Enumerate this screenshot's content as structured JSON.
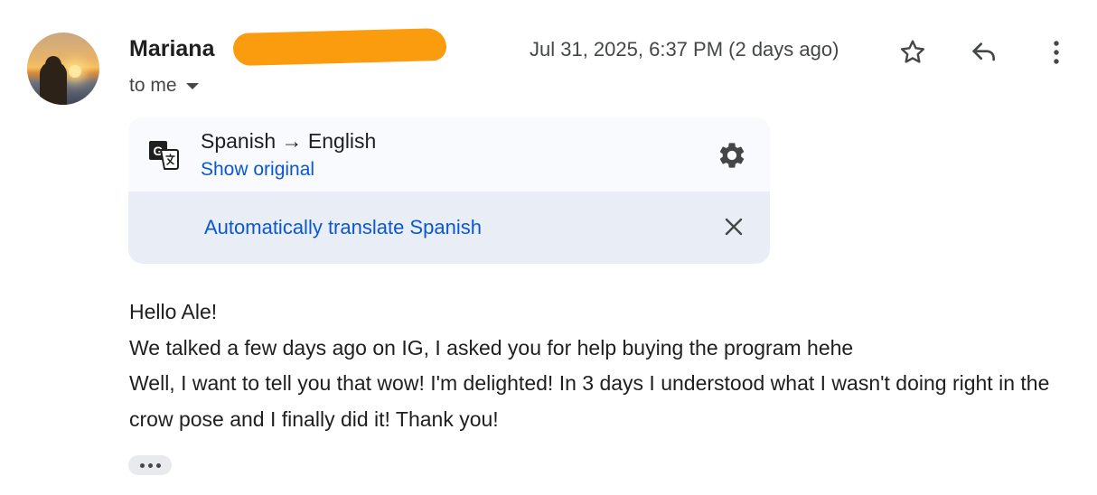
{
  "header": {
    "sender_name": "Mariana",
    "recipient_text": "to me",
    "date": "Jul 31, 2025, 6:37 PM (2 days ago)",
    "icons": [
      "avatar",
      "star-icon",
      "reply-icon",
      "more-vert-icon"
    ]
  },
  "translation": {
    "language_line": "Spanish → English",
    "show_original": "Show original",
    "auto_translate": "Automatically translate Spanish",
    "icons": [
      "translate-icon",
      "gear-icon",
      "close-icon"
    ]
  },
  "message": {
    "lines": [
      "Hello Ale!",
      "We talked a few days ago on IG, I asked you for help buying the program hehe",
      "Well, I want to tell you that wow! I'm delighted! In 3 days I understood what I wasn't doing right in the crow pose and I finally did it! Thank you!"
    ],
    "icons": [
      "more-horiz-icon"
    ]
  },
  "colors": {
    "link": "#0b57d0",
    "redaction": "#fb9b0e",
    "text": "#1f1f1f",
    "muted": "#444746",
    "card_top": "#f8fafd",
    "card_bottom": "#e9eef6"
  }
}
